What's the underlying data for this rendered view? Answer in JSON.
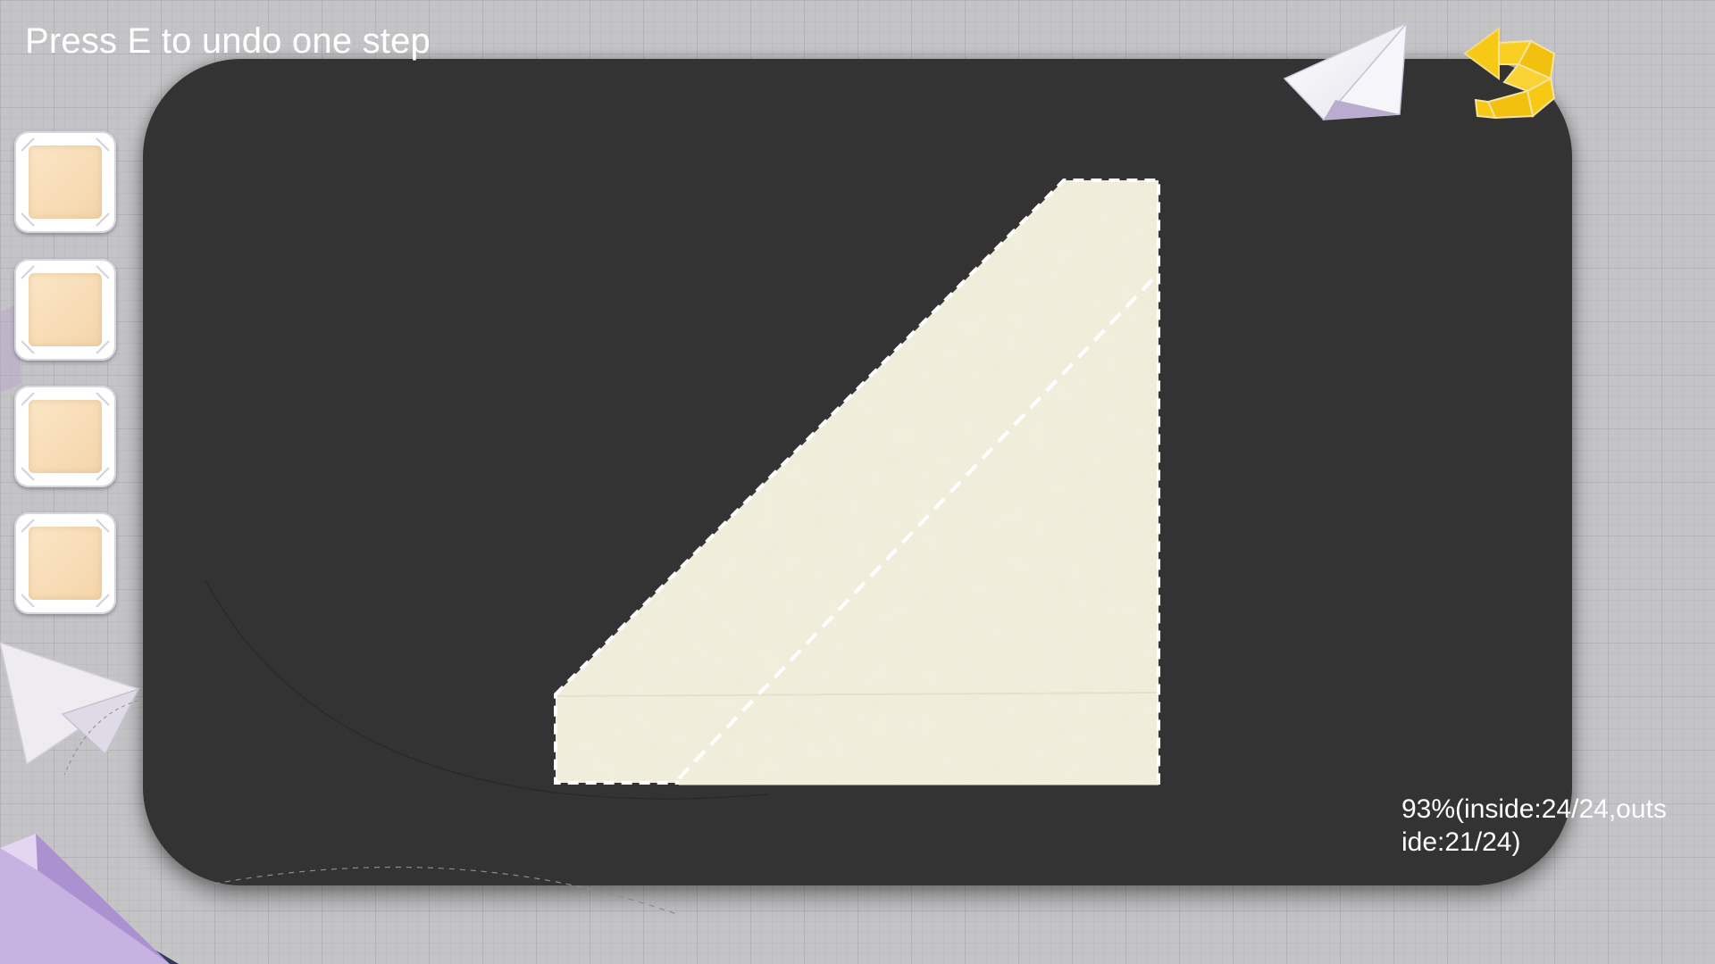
{
  "hint": "Press E to undo one step",
  "score": "93%(inside:24/24,outside:21/24)",
  "slots": [
    {
      "id": "slot-1"
    },
    {
      "id": "slot-2"
    },
    {
      "id": "slot-3"
    },
    {
      "id": "slot-4"
    }
  ],
  "icons": {
    "undo": "undo-arrow-icon",
    "plane": "paper-plane-icon"
  },
  "colors": {
    "board": "#333333",
    "paper": "#f2efdd",
    "undo_icon": "#f7c915",
    "fold_line": "#ffffff"
  }
}
